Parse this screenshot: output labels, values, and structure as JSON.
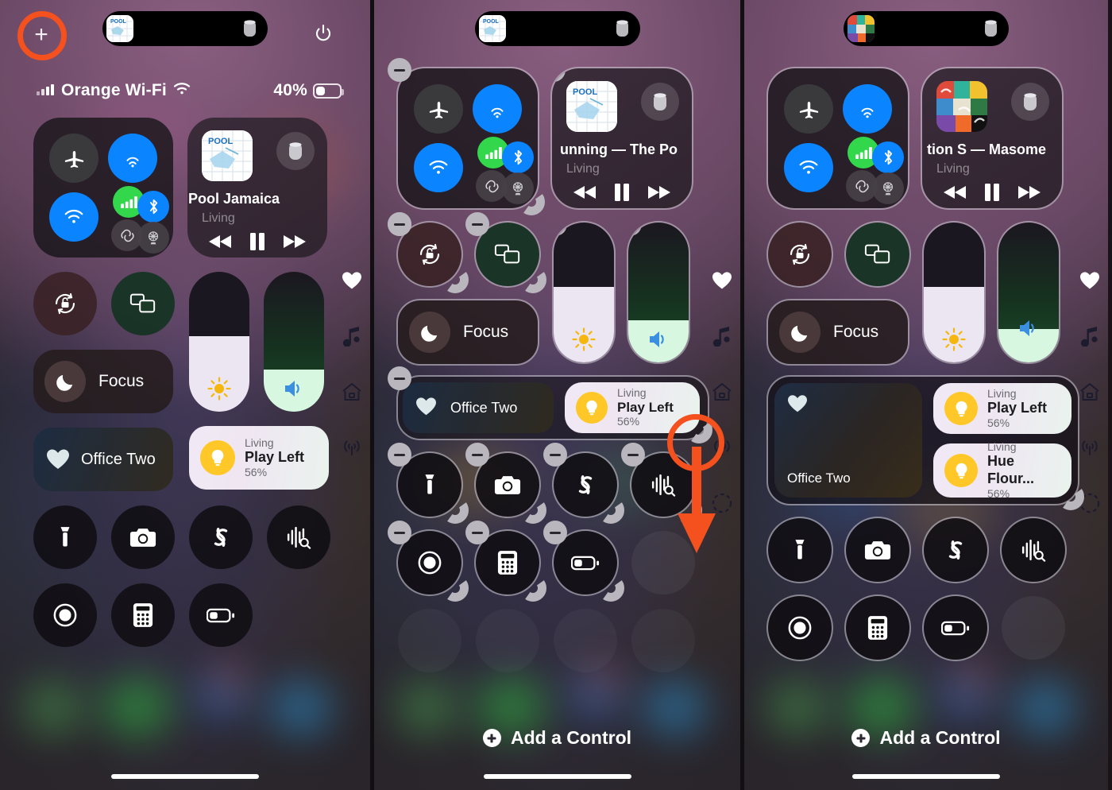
{
  "meta": {
    "screen": "iOS Control Center",
    "accent_annotation": "#f4511e"
  },
  "status_bar": {
    "carrier": "Orange Wi-Fi",
    "battery_percent": "40%",
    "signal_icon": "cellular-bars-icon",
    "wifi_icon": "wifi-icon",
    "battery_icon": "battery-icon"
  },
  "dynamic_island": {
    "left_icon": "now-playing-artwork",
    "right_icon": "homepod-icon"
  },
  "top_bar": {
    "add_label": "+",
    "add_icon": "plus-icon",
    "power_icon": "power-icon"
  },
  "connectivity": {
    "airplane": "airplane-mode-icon",
    "airdrop": "airdrop-icon",
    "wifi": "wifi-icon",
    "cellular": "cellular-data-icon",
    "bluetooth": "bluetooth-icon",
    "personal_hotspot": "personal-hotspot-icon",
    "satellite": "satellite-icon"
  },
  "media": {
    "panel1": {
      "title": "e Pool      Jamaica",
      "subtitle": "Living",
      "artwork": "pool-album-art"
    },
    "panel2": {
      "title": "unning — The Po",
      "subtitle": "Living",
      "artwork": "pool-album-art"
    },
    "panel3": {
      "title": "tion S — Masome",
      "subtitle": "Living",
      "artwork": "colorful-album-art"
    },
    "controls": {
      "back": "rewind-icon",
      "play": "pause-icon",
      "forward": "fast-forward-icon"
    },
    "destination_icon": "homepod-icon"
  },
  "toggles": {
    "rotation_lock": "rotation-lock-icon",
    "screen_mirroring": "screen-mirroring-icon",
    "focus_label": "Focus",
    "focus_icon": "moon-icon"
  },
  "sliders": {
    "brightness": {
      "icon": "brightness-icon",
      "level": 54
    },
    "volume": {
      "icon": "volume-icon",
      "level": 30
    }
  },
  "home": {
    "scene_label": "Office Two",
    "scene_icon": "heart-icon",
    "lights": [
      {
        "room": "Living",
        "name": "Play Left",
        "percent": "56%",
        "icon": "lightbulb-icon"
      },
      {
        "room": "Living",
        "name": "Hue Flour...",
        "percent": "56%",
        "icon": "lightbulb-icon"
      }
    ]
  },
  "apps_row1": [
    {
      "name": "flashlight-icon"
    },
    {
      "name": "camera-icon"
    },
    {
      "name": "shazam-icon"
    },
    {
      "name": "sound-recognition-icon"
    }
  ],
  "apps_row2": [
    {
      "name": "screen-record-icon"
    },
    {
      "name": "calculator-icon"
    },
    {
      "name": "low-power-mode-icon"
    }
  ],
  "rail": {
    "panel1": [
      "favorites-heart-icon",
      "music-note-icon",
      "home-icon",
      "connectivity-antenna-icon"
    ],
    "panel2": [
      "favorites-heart-icon",
      "music-note-icon",
      "home-icon",
      "connectivity-antenna-icon",
      "add-page-dashed-icon"
    ],
    "panel3": [
      "favorites-heart-icon",
      "music-note-icon",
      "home-icon",
      "connectivity-antenna-icon",
      "add-page-dashed-icon"
    ]
  },
  "footer": {
    "add_control_label": "Add a Control",
    "add_control_icon": "plus-circle-icon"
  },
  "edit_mode": {
    "remove_badge_icon": "minus-badge-icon",
    "resize_handle_icon": "resize-grip-icon"
  }
}
